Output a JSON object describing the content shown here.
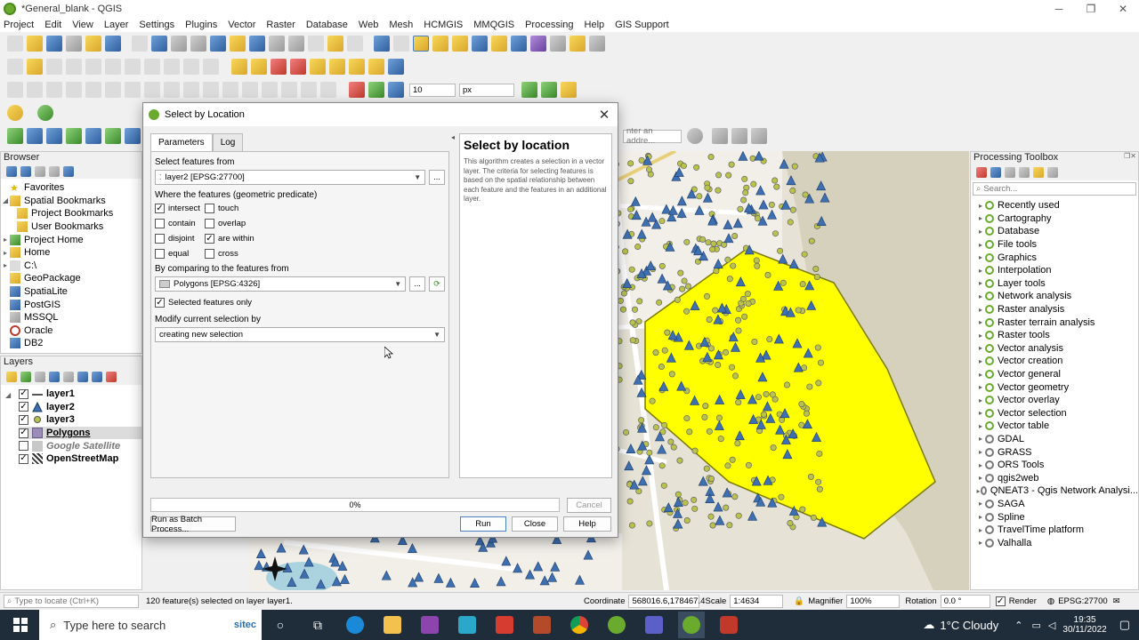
{
  "window": {
    "title": "*General_blank - QGIS",
    "controls": [
      "─",
      "❐",
      "✕"
    ]
  },
  "menu": [
    "Project",
    "Edit",
    "View",
    "Layer",
    "Settings",
    "Plugins",
    "Vector",
    "Raster",
    "Database",
    "Web",
    "Mesh",
    "HCMGIS",
    "MMQGIS",
    "Processing",
    "Help",
    "GIS Support"
  ],
  "toolbar": {
    "snap_tolerance": "10",
    "snap_units": "px",
    "locator_placeholder": "nter an addre..."
  },
  "browser": {
    "title": "Browser",
    "items": [
      {
        "label": "Favorites",
        "arrow": "",
        "icon": "star"
      },
      {
        "label": "Spatial Bookmarks",
        "arrow": "◢",
        "icon": "folder"
      },
      {
        "label": "Project Bookmarks",
        "arrow": "",
        "icon": "folder",
        "indent": 2
      },
      {
        "label": "User Bookmarks",
        "arrow": "",
        "icon": "folder",
        "indent": 2
      },
      {
        "label": "Project Home",
        "arrow": "▸",
        "icon": "folder"
      },
      {
        "label": "Home",
        "arrow": "▸",
        "icon": "folder"
      },
      {
        "label": "C:\\",
        "arrow": "▸",
        "icon": "drive"
      },
      {
        "label": "GeoPackage",
        "arrow": "",
        "icon": "gpkg"
      },
      {
        "label": "SpatiaLite",
        "arrow": "",
        "icon": "spatialite"
      },
      {
        "label": "PostGIS",
        "arrow": "",
        "icon": "postgis"
      },
      {
        "label": "MSSQL",
        "arrow": "",
        "icon": "mssql"
      },
      {
        "label": "Oracle",
        "arrow": "",
        "icon": "oracle"
      },
      {
        "label": "DB2",
        "arrow": "",
        "icon": "db2"
      }
    ]
  },
  "layers": {
    "title": "Layers",
    "items": [
      {
        "label": "layer1",
        "checked": true,
        "style": "bold",
        "symbol": "line"
      },
      {
        "label": "layer2",
        "checked": true,
        "style": "bold",
        "symbol": "triangle"
      },
      {
        "label": "layer3",
        "checked": true,
        "style": "bold",
        "symbol": "point"
      },
      {
        "label": "Polygons",
        "checked": true,
        "style": "bold-underline",
        "symbol": "polygon"
      },
      {
        "label": "Google Satellite",
        "checked": false,
        "style": "italic",
        "symbol": "raster"
      },
      {
        "label": "OpenStreetMap",
        "checked": true,
        "style": "bold",
        "symbol": "raster"
      }
    ]
  },
  "dialog": {
    "title": "Select by Location",
    "tabs": [
      "Parameters",
      "Log"
    ],
    "select_from_label": "Select features from",
    "select_from_value": "layer2 [EPSG:27700]",
    "predicate_label": "Where the features (geometric predicate)",
    "predicates": [
      {
        "label": "intersect",
        "checked": true
      },
      {
        "label": "touch",
        "checked": false
      },
      {
        "label": "contain",
        "checked": false
      },
      {
        "label": "overlap",
        "checked": false
      },
      {
        "label": "disjoint",
        "checked": false
      },
      {
        "label": "are within",
        "checked": true
      },
      {
        "label": "equal",
        "checked": false
      },
      {
        "label": "cross",
        "checked": false
      }
    ],
    "compare_label": "By comparing to the features from",
    "compare_value": "Polygons [EPSG:4326]",
    "selected_only_label": "Selected features only",
    "modify_label": "Modify current selection by",
    "modify_value": "creating new selection",
    "help_title": "Select by location",
    "help_text": "This algorithm creates a selection in a vector layer. The criteria for selecting features is based on the spatial relationship between each feature and the features in an additional layer.",
    "progress": "0%",
    "buttons": {
      "batch": "Run as Batch Process...",
      "run": "Run",
      "close": "Close",
      "help": "Help",
      "cancel": "Cancel",
      "more": "..."
    }
  },
  "toolbox": {
    "title": "Processing Toolbox",
    "search_placeholder": "Search...",
    "items": [
      "Recently used",
      "Cartography",
      "Database",
      "File tools",
      "Graphics",
      "Interpolation",
      "Layer tools",
      "Network analysis",
      "Raster analysis",
      "Raster terrain analysis",
      "Raster tools",
      "Vector analysis",
      "Vector creation",
      "Vector general",
      "Vector geometry",
      "Vector overlay",
      "Vector selection",
      "Vector table",
      "GDAL",
      "GRASS",
      "ORS Tools",
      "qgis2web",
      "QNEAT3 - Qgis Network Analysi...",
      "SAGA",
      "Spline",
      "TravelTime platform",
      "Valhalla"
    ]
  },
  "status": {
    "locate_placeholder": "Type to locate (Ctrl+K)",
    "message": "120 feature(s) selected on layer layer1.",
    "coordinate_label": "Coordinate",
    "coordinate": "568016.6,178467.4",
    "scale_label": "Scale",
    "scale": "1:4634",
    "magnifier_label": "Magnifier",
    "magnifier": "100%",
    "rotation_label": "Rotation",
    "rotation": "0.0 °",
    "render_label": "Render",
    "crs": "EPSG:27700"
  },
  "taskbar": {
    "search_placeholder": "Type here to search",
    "weather": "1°C  Cloudy",
    "time": "19:35",
    "date": "30/11/2022",
    "sitec": "sitec"
  },
  "colors": {
    "polygon_fill": "#ffff00",
    "polygon_stroke": "#7a7a00",
    "point_fill": "#b9c24a",
    "triangle_fill": "#3e6fb0",
    "qgis_green": "#6aab2e"
  }
}
